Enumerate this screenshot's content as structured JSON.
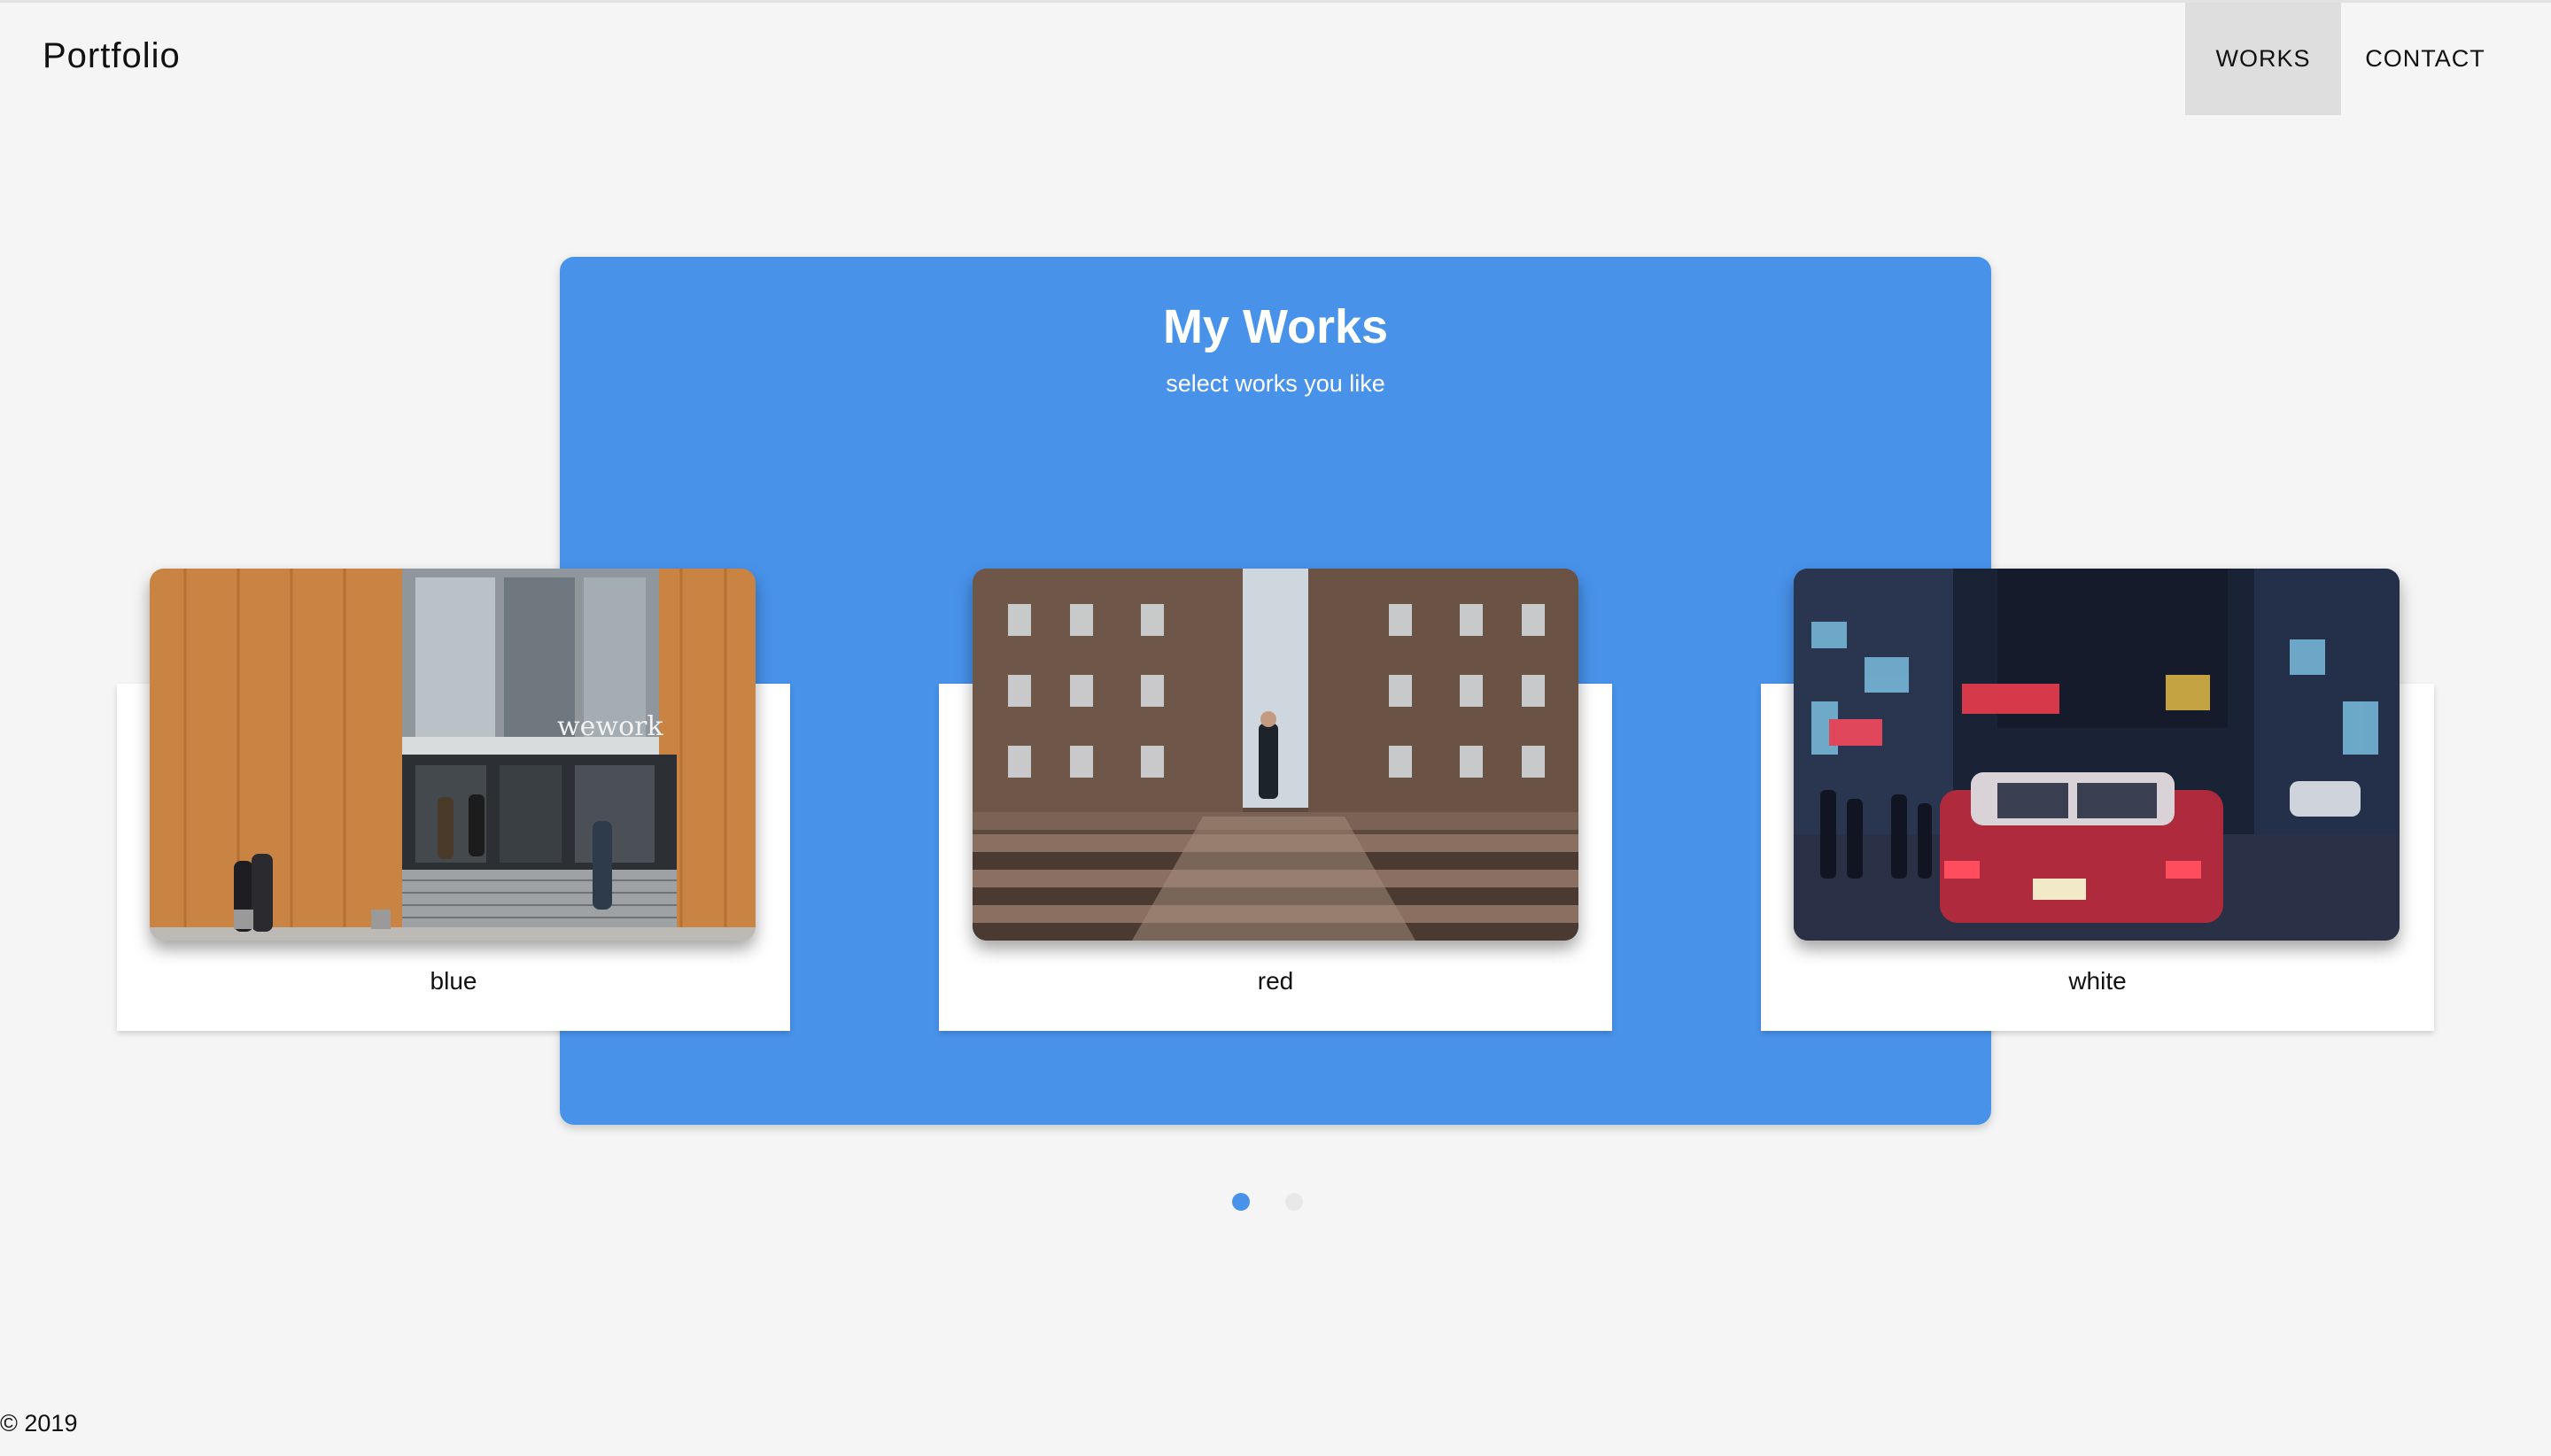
{
  "header": {
    "brand": "Portfolio",
    "nav": [
      {
        "label": "WORKS",
        "active": true
      },
      {
        "label": "CONTACT",
        "active": false
      }
    ]
  },
  "hero": {
    "title": "My Works",
    "subtitle": "select works you like",
    "color": "#4892ea"
  },
  "works": [
    {
      "label": "blue",
      "image": "office-building-photo"
    },
    {
      "label": "red",
      "image": "brick-building-stairs-photo"
    },
    {
      "label": "white",
      "image": "night-street-taxi-photo"
    }
  ],
  "pagination": {
    "current": 1,
    "total": 2,
    "active_color": "#4892ea",
    "inactive_color": "#e8e8e8"
  },
  "footer": {
    "copyright": "© 2019"
  }
}
